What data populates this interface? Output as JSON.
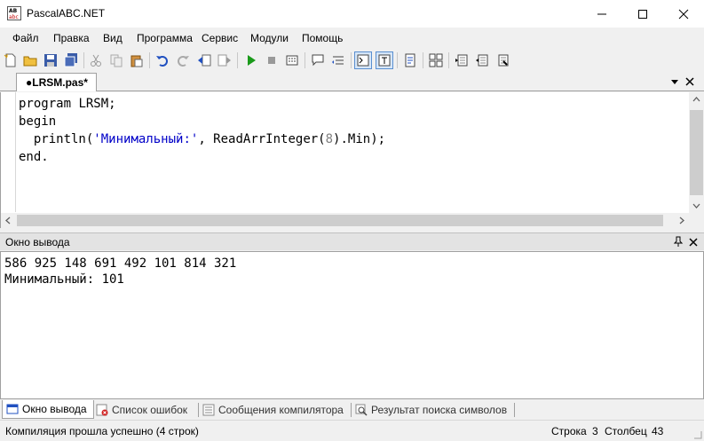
{
  "window": {
    "title": "PascalABC.NET",
    "icon_text": "AB abc"
  },
  "menu": [
    "Файл",
    "Правка",
    "Вид",
    "Программа",
    "Сервис",
    "Модули",
    "Помощь"
  ],
  "editor": {
    "tab_label": "●LRSM.pas*",
    "code": {
      "line1_kw": "program",
      "line1_rest": " LRSM;",
      "line2_kw": "begin",
      "line3_a": "  println(",
      "line3_str": "'Минимальный:'",
      "line3_b": ", ReadArrInteger(",
      "line3_num": "8",
      "line3_c": ").Min);",
      "line4_kw": "end",
      "line4_rest": "."
    }
  },
  "output": {
    "title": "Окно вывода",
    "line1": "586 925 148 691 492 101 814 321",
    "line2": "Минимальный: 101"
  },
  "bottom_tabs": [
    "Окно вывода",
    "Список ошибок",
    "Сообщения компилятора",
    "Результат поиска символов"
  ],
  "status": {
    "message": "Компиляция прошла успешно (4 строк)",
    "row_label": "Строка",
    "row_value": "3",
    "col_label": "Столбец",
    "col_value": "43"
  },
  "colors": {
    "string_literal": "#0000c8",
    "number_literal": "#7f7f7f",
    "accent": "#5a8fd0"
  }
}
